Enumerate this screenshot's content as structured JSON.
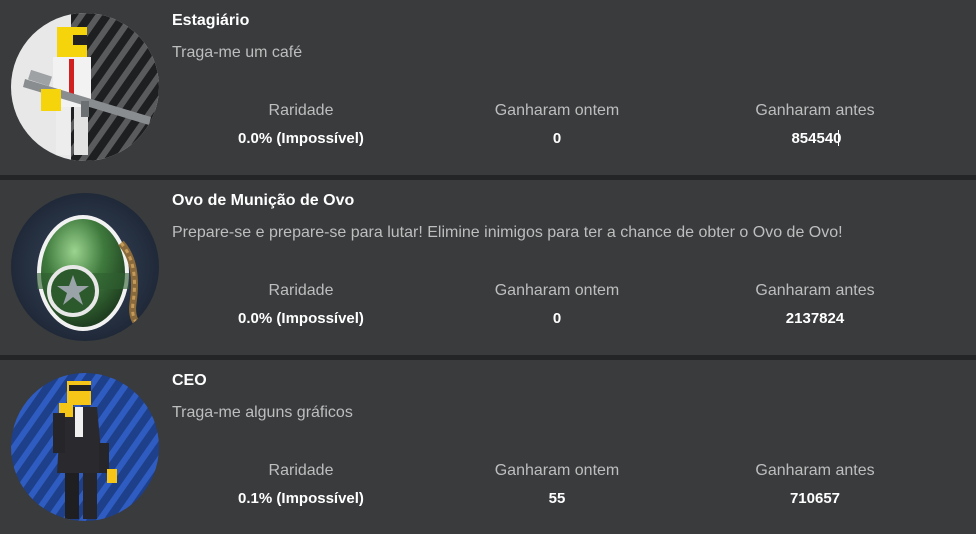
{
  "colors": {
    "page_bg": "#232527",
    "card_bg": "#393b3d",
    "label_text": "#bdbebe",
    "value_text": "#ffffff"
  },
  "stat_labels": {
    "rarity": "Raridade",
    "won_yesterday": "Ganharam ontem",
    "won_before": "Ganharam antes"
  },
  "badges": [
    {
      "icon": "intern-rifle-avatar-icon",
      "title": "Estagiário",
      "description": "Traga-me um café",
      "rarity": "0.0% (Impossível)",
      "won_yesterday": "0",
      "won_before": "854540"
    },
    {
      "icon": "green-egg-grenade-icon",
      "title": "Ovo de Munição de Ovo",
      "description": "Prepare-se e prepare-se para lutar! Elimine inimigos para ter a chance de obter o Ovo de Ovo!",
      "rarity": "0.0% (Impossível)",
      "won_yesterday": "0",
      "won_before": "2137824"
    },
    {
      "icon": "ceo-suit-avatar-icon",
      "title": "CEO",
      "description": "Traga-me alguns gráficos",
      "rarity": "0.1% (Impossível)",
      "won_yesterday": "55",
      "won_before": "710657"
    }
  ]
}
